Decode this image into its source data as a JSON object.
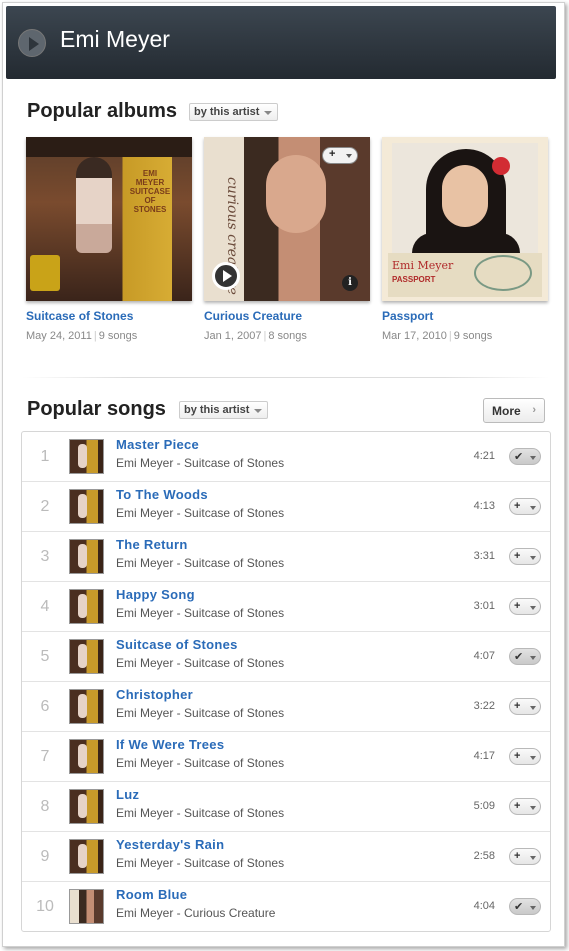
{
  "header": {
    "artist": "Emi Meyer"
  },
  "albums_section": {
    "title": "Popular albums",
    "filter": "by this artist",
    "albums": [
      {
        "title": "Suitcase of Stones",
        "date": "May 24, 2011",
        "songs": "9 songs",
        "cover_text": "EMI MEYER SUITCASE OF STONES"
      },
      {
        "title": "Curious Creature",
        "date": "Jan 1, 2007",
        "songs": "8 songs",
        "cover_text": "curious creature"
      },
      {
        "title": "Passport",
        "date": "Mar 17, 2010",
        "songs": "9 songs",
        "cover_text": "Emi Meyer",
        "cover_subtext": "PASSPORT"
      }
    ],
    "hover_controls": {
      "add_symbol": "+",
      "info_symbol": "i"
    }
  },
  "songs_section": {
    "title": "Popular songs",
    "filter": "by this artist",
    "more_label": "More",
    "more_chevron": "›",
    "songs": [
      {
        "num": "1",
        "title": "Master Piece",
        "artist": "Emi Meyer",
        "album": "Suitcase of Stones",
        "duration": "4:21",
        "status": "added",
        "symbol": "✔"
      },
      {
        "num": "2",
        "title": "To The Woods",
        "artist": "Emi Meyer",
        "album": "Suitcase of Stones",
        "duration": "4:13",
        "status": "add",
        "symbol": "+"
      },
      {
        "num": "3",
        "title": "The Return",
        "artist": "Emi Meyer",
        "album": "Suitcase of Stones",
        "duration": "3:31",
        "status": "add",
        "symbol": "+"
      },
      {
        "num": "4",
        "title": "Happy Song",
        "artist": "Emi Meyer",
        "album": "Suitcase of Stones",
        "duration": "3:01",
        "status": "add",
        "symbol": "+"
      },
      {
        "num": "5",
        "title": "Suitcase of Stones",
        "artist": "Emi Meyer",
        "album": "Suitcase of Stones",
        "duration": "4:07",
        "status": "added",
        "symbol": "✔"
      },
      {
        "num": "6",
        "title": "Christopher",
        "artist": "Emi Meyer",
        "album": "Suitcase of Stones",
        "duration": "3:22",
        "status": "add",
        "symbol": "+"
      },
      {
        "num": "7",
        "title": "If We Were Trees",
        "artist": "Emi Meyer",
        "album": "Suitcase of Stones",
        "duration": "4:17",
        "status": "add",
        "symbol": "+"
      },
      {
        "num": "8",
        "title": "Luz",
        "artist": "Emi Meyer",
        "album": "Suitcase of Stones",
        "duration": "5:09",
        "status": "add",
        "symbol": "+"
      },
      {
        "num": "9",
        "title": "Yesterday's Rain",
        "artist": "Emi Meyer",
        "album": "Suitcase of Stones",
        "duration": "2:58",
        "status": "add",
        "symbol": "+"
      },
      {
        "num": "10",
        "title": "Room Blue",
        "artist": "Emi Meyer",
        "album": "Curious Creature",
        "duration": "4:04",
        "status": "added",
        "symbol": "✔"
      }
    ]
  },
  "colors": {
    "link": "#2a6bb8",
    "header_bg": "#2c343b"
  }
}
